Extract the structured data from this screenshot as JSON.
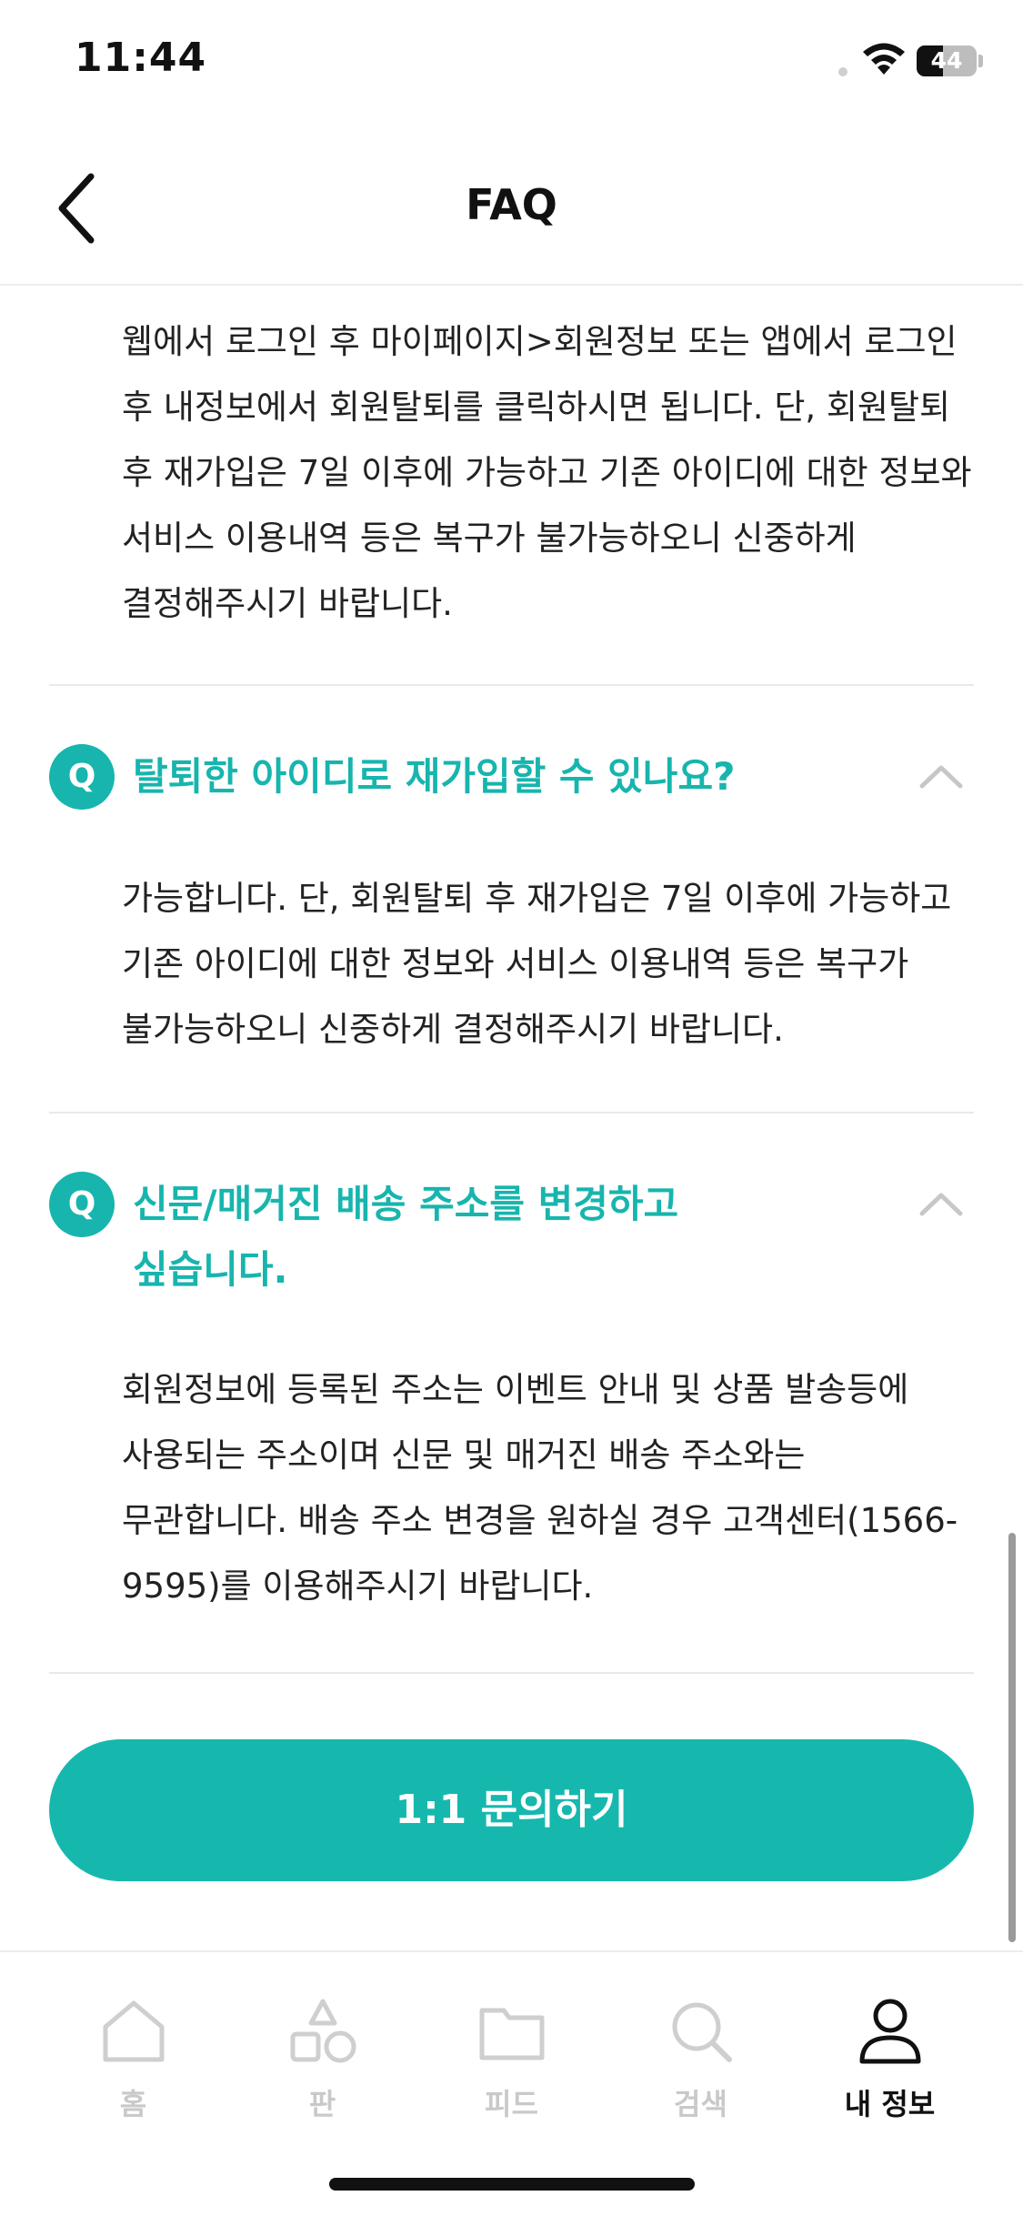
{
  "status_bar": {
    "time": "11:44",
    "battery_level": "44",
    "battery_fraction": 0.44
  },
  "header": {
    "title": "FAQ",
    "back_icon": "chevron-left-icon"
  },
  "faq": {
    "items": [
      {
        "answer": "웹에서 로그인 후 마이페이지>회원정보 또는 앱에서 로그인 후 내정보에서 회원탈퇴를 클릭하시면 됩니다. 단, 회원탈퇴 후 재가입은 7일 이후에 가능하고 기존 아이디에 대한 정보와 서비스 이용내역 등은 복구가 불가능하오니 신중하게 결정해주시기 바랍니다."
      },
      {
        "badge": "Q",
        "question": "탈퇴한 아이디로 재가입할 수 있나요?",
        "expanded": true,
        "answer": "가능합니다. 단, 회원탈퇴 후 재가입은 7일 이후에 가능하고 기존 아이디에 대한 정보와 서비스 이용내역 등은 복구가 불가능하오니 신중하게 결정해주시기 바랍니다."
      },
      {
        "badge": "Q",
        "question": "신문/매거진 배송 주소를 변경하고 싶습니다.",
        "expanded": true,
        "answer": "회원정보에 등록된 주소는 이벤트 안내 및 상품 발송등에 사용되는 주소이며 신문 및 매거진 배송 주소와는 무관합니다. 배송 주소 변경을 원하실 경우 고객센터(1566-9595)를 이용해주시기 바랍니다."
      }
    ]
  },
  "inquiry_button": {
    "label": "1:1 문의하기"
  },
  "tab_bar": {
    "items": [
      {
        "label": "홈",
        "icon": "home-icon",
        "active": false
      },
      {
        "label": "판",
        "icon": "shapes-icon",
        "active": false
      },
      {
        "label": "피드",
        "icon": "folder-icon",
        "active": false
      },
      {
        "label": "검색",
        "icon": "search-icon",
        "active": false
      },
      {
        "label": "내 정보",
        "icon": "user-icon",
        "active": true
      }
    ]
  },
  "colors": {
    "accent": "#17b5ad",
    "inactive_tab": "#c9c9c9",
    "active_tab": "#111111"
  }
}
